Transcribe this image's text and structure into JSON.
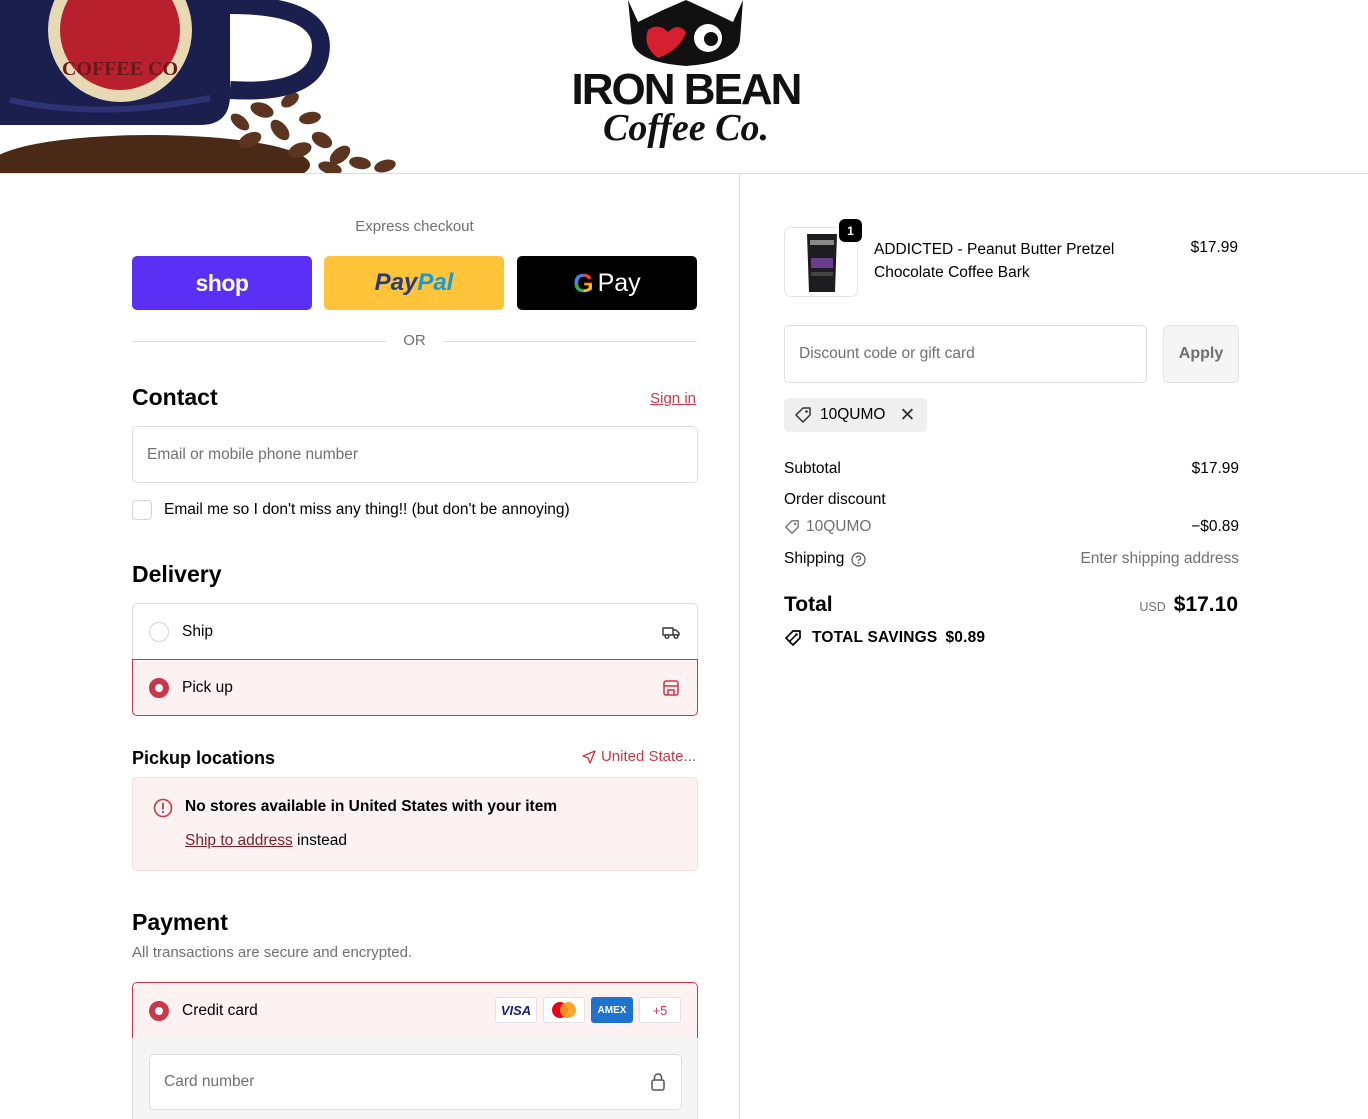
{
  "brand": {
    "logo_line1": "IRON BEAN",
    "logo_line2": "Coffee Co.",
    "mug_text": "COFFEE CO"
  },
  "express": {
    "title": "Express checkout",
    "shop_label": "shop",
    "paypal_label_1": "Pay",
    "paypal_label_2": "Pal",
    "gpay_g": "G",
    "gpay_label": "Pay",
    "or_label": "OR"
  },
  "contact": {
    "heading": "Contact",
    "sign_in": "Sign in",
    "email_placeholder": "Email or mobile phone number",
    "newsletter_label": "Email me so I don't miss any thing!! (but don't be annoying)"
  },
  "delivery": {
    "heading": "Delivery",
    "options": [
      {
        "label": "Ship",
        "selected": false,
        "icon": "truck-icon"
      },
      {
        "label": "Pick up",
        "selected": true,
        "icon": "store-icon"
      }
    ]
  },
  "pickup": {
    "heading": "Pickup locations",
    "country": "United State...",
    "notice_title": "No stores available in United States with your item",
    "notice_link": "Ship to address",
    "notice_suffix": " instead"
  },
  "payment": {
    "heading": "Payment",
    "subtitle": "All transactions are secure and encrypted.",
    "method_label": "Credit card",
    "card_brands": [
      "VISA",
      "",
      "AMEX",
      "+5"
    ],
    "card_number_placeholder": "Card number"
  },
  "summary": {
    "product_name": "ADDICTED - Peanut Butter Pretzel Chocolate Coffee Bark",
    "product_price": "$17.99",
    "quantity": "1",
    "discount_placeholder": "Discount code or gift card",
    "apply_label": "Apply",
    "applied_code": "10QUMO",
    "subtotal_label": "Subtotal",
    "subtotal_value": "$17.99",
    "order_discount_label": "Order discount",
    "discount_code": "10QUMO",
    "discount_value": "−$0.89",
    "shipping_label": "Shipping",
    "shipping_value": "Enter shipping address",
    "total_label": "Total",
    "currency": "USD",
    "total_value": "$17.10",
    "savings_label": "TOTAL SAVINGS",
    "savings_value": "$0.89"
  },
  "colors": {
    "accent": "#c8384a",
    "shop": "#5a31f4",
    "paypal": "#ffc439",
    "selected_bg": "#fdf2f2"
  }
}
